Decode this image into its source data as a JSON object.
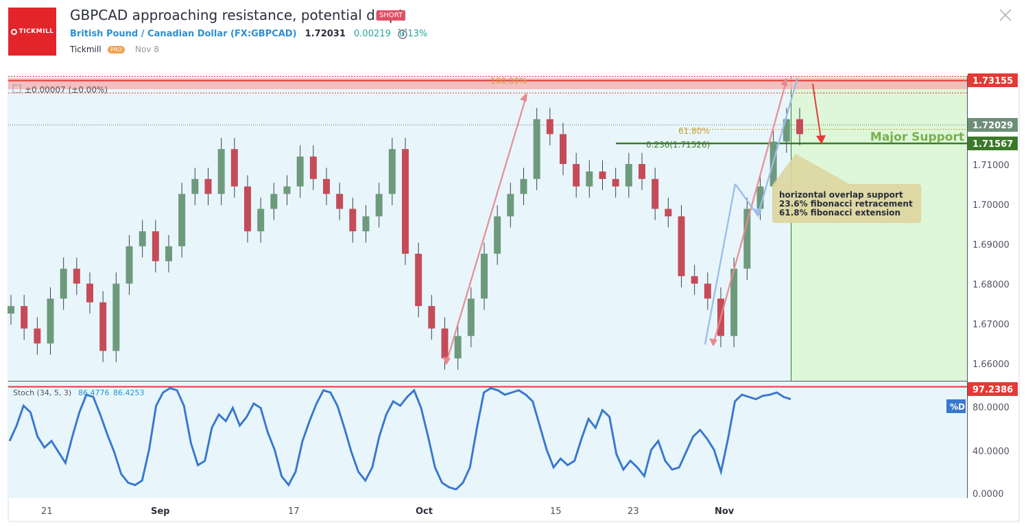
{
  "header": {
    "logo_text": "TICKMILL",
    "title": "GBPCAD approaching resistance, potential drop!",
    "badge": "SHORT",
    "symbol_name": "British Pound / Canadian Dollar (FX:GBPCAD)",
    "price": "1.72031",
    "change": "0.00219",
    "change_pct": "0.13%",
    "author": "Tickmill",
    "author_badge": "PRO",
    "date": "Nov 8"
  },
  "chart_data": [
    {
      "type": "candlestick",
      "title": "GBPCAD",
      "x_ticks": [
        "21",
        "Sep",
        "17",
        "Oct",
        "15",
        "23",
        "Nov"
      ],
      "y_ticks": [
        "1.71000",
        "1.70000",
        "1.69000",
        "1.68000",
        "1.67000",
        "1.66000"
      ],
      "ylim": [
        1.654,
        1.7355
      ],
      "x": [
        "Aug 16",
        "Aug 17",
        "Aug 20",
        "Aug 21",
        "Aug 22",
        "Aug 23",
        "Aug 24",
        "Aug 27",
        "Aug 28",
        "Aug 29",
        "Aug 30",
        "Aug 31",
        "Sep 3",
        "Sep 4",
        "Sep 5",
        "Sep 6",
        "Sep 7",
        "Sep 10",
        "Sep 11",
        "Sep 12",
        "Sep 13",
        "Sep 14",
        "Sep 17",
        "Sep 18",
        "Sep 19",
        "Sep 20",
        "Sep 21",
        "Sep 24",
        "Sep 25",
        "Sep 26",
        "Sep 27",
        "Sep 28",
        "Oct 1",
        "Oct 2",
        "Oct 3",
        "Oct 4",
        "Oct 5",
        "Oct 8",
        "Oct 9",
        "Oct 10",
        "Oct 11",
        "Oct 12",
        "Oct 15",
        "Oct 16",
        "Oct 17",
        "Oct 18",
        "Oct 19",
        "Oct 22",
        "Oct 23",
        "Oct 24",
        "Oct 25",
        "Oct 26",
        "Oct 29",
        "Oct 30",
        "Oct 31",
        "Nov 1",
        "Nov 2",
        "Nov 5",
        "Nov 6",
        "Nov 7",
        "Nov 8"
      ],
      "close": [
        1.674,
        1.668,
        1.664,
        1.676,
        1.684,
        1.68,
        1.675,
        1.662,
        1.68,
        1.69,
        1.694,
        1.686,
        1.69,
        1.704,
        1.708,
        1.704,
        1.716,
        1.706,
        1.694,
        1.7,
        1.704,
        1.706,
        1.714,
        1.708,
        1.704,
        1.7,
        1.694,
        1.698,
        1.704,
        1.716,
        1.688,
        1.674,
        1.668,
        1.66,
        1.666,
        1.676,
        1.688,
        1.698,
        1.704,
        1.708,
        1.724,
        1.72,
        1.712,
        1.706,
        1.71,
        1.708,
        1.706,
        1.712,
        1.708,
        1.7,
        1.698,
        1.682,
        1.68,
        1.676,
        1.666,
        1.684,
        1.7,
        1.706,
        1.718,
        1.724,
        1.72
      ],
      "price_labels": [
        "1.73155",
        "1.72029",
        "1.71567"
      ],
      "resistance": 1.73155,
      "current": 1.72029,
      "support": 1.71567,
      "fib_labels": [
        "100.00%",
        "61.80%",
        "0.236(1.71526)"
      ],
      "support_label": "Major Support",
      "info_label": "±0.00007 (±0.00%)",
      "annotation": [
        "horizontal overlap support",
        "23.6% fibonacci retracement",
        "61.8% fibonacci extension"
      ]
    },
    {
      "type": "line",
      "title": "Stoch (34, 5, 3)",
      "legend_values": [
        "86.4776",
        "86.4253"
      ],
      "y_ticks": [
        "80.0000",
        "40.0000",
        "0.0000"
      ],
      "ylim": [
        -4,
        102
      ],
      "level_label": "97.2386",
      "level": 97.2386,
      "series_label": "%D",
      "values": [
        48,
        62,
        80,
        74,
        52,
        42,
        48,
        38,
        28,
        52,
        74,
        90,
        88,
        72,
        54,
        38,
        18,
        10,
        8,
        12,
        40,
        80,
        92,
        96,
        94,
        80,
        46,
        26,
        30,
        60,
        72,
        66,
        78,
        62,
        70,
        82,
        78,
        56,
        40,
        16,
        8,
        20,
        48,
        66,
        82,
        94,
        92,
        80,
        60,
        38,
        20,
        12,
        24,
        52,
        72,
        84,
        80,
        88,
        94,
        78,
        52,
        24,
        10,
        6,
        4,
        10,
        24,
        60,
        92,
        96,
        94,
        90,
        92,
        94,
        90,
        84,
        62,
        40,
        24,
        32,
        26,
        30,
        50,
        68,
        60,
        76,
        70,
        36,
        22,
        30,
        24,
        16,
        40,
        48,
        30,
        22,
        24,
        38,
        52,
        58,
        50,
        40,
        20,
        50,
        84,
        90,
        88,
        86,
        89,
        90,
        92,
        88,
        86
      ]
    }
  ]
}
